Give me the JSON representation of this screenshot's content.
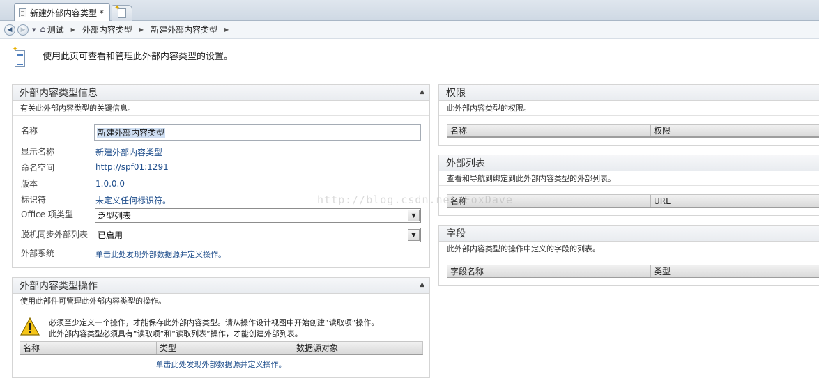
{
  "tab": {
    "title": "新建外部内容类型 *"
  },
  "breadcrumb": {
    "items": [
      "测试",
      "外部内容类型",
      "新建外部内容类型"
    ]
  },
  "header": {
    "text": "使用此页可查看和管理此外部内容类型的设置。"
  },
  "info_panel": {
    "title": "外部内容类型信息",
    "description": "有关此外部内容类型的关键信息。",
    "fields": {
      "name_label": "名称",
      "name_value": "新建外部内容类型",
      "display_name_label": "显示名称",
      "display_name_value": "新建外部内容类型",
      "namespace_label": "命名空间",
      "namespace_value": "http://spf01:1291",
      "version_label": "版本",
      "version_value": "1.0.0.0",
      "identifier_label": "标识符",
      "identifier_value": "未定义任何标识符。",
      "office_type_label": "Office 项类型",
      "office_type_value": "泛型列表",
      "offline_sync_label": "脱机同步外部列表",
      "offline_sync_value": "已启用",
      "external_system_label": "外部系统",
      "external_system_value": "单击此处发现外部数据源并定义操作。"
    }
  },
  "operations_panel": {
    "title": "外部内容类型操作",
    "description": "使用此部件可管理此外部内容类型的操作。",
    "warning_line1": "必须至少定义一个操作，才能保存此外部内容类型。请从操作设计视图中开始创建“读取项”操作。",
    "warning_line2": "此外部内容类型必须具有“读取项”和“读取列表”操作，才能创建外部列表。",
    "columns": [
      "名称",
      "类型",
      "数据源对象"
    ],
    "link": "单击此处发现外部数据源并定义操作。"
  },
  "permissions_panel": {
    "title": "权限",
    "description": "此外部内容类型的权限。",
    "columns": [
      "名称",
      "权限"
    ]
  },
  "external_lists_panel": {
    "title": "外部列表",
    "description": "查看和导航到绑定到此外部内容类型的外部列表。",
    "columns": [
      "名称",
      "URL"
    ]
  },
  "fields_panel": {
    "title": "字段",
    "description": "此外部内容类型的操作中定义的字段的列表。",
    "columns": [
      "字段名称",
      "类型"
    ]
  },
  "watermark": "http://blog.csdn.net/FoxDave"
}
